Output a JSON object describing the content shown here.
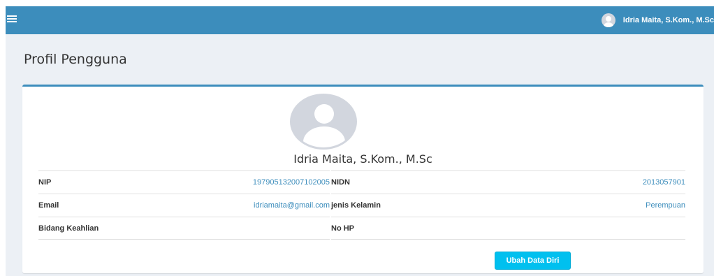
{
  "header": {
    "menu_icon": "hamburger-menu-icon",
    "user_name": "Idria Maita, S.Kom., M.Sc",
    "brand_color": "#3c8dbc"
  },
  "page": {
    "title": "Profil Pengguna"
  },
  "profile": {
    "name": "Idria Maita, S.Kom., M.Sc",
    "left": [
      {
        "label": "NIP",
        "value": "197905132007102005"
      },
      {
        "label": "Email",
        "value": "idriamaita@gmail.com"
      },
      {
        "label": "Bidang Keahlian",
        "value": ""
      }
    ],
    "right": [
      {
        "label": "NIDN",
        "value": "2013057901"
      },
      {
        "label": "jenis Kelamin",
        "value": "Perempuan"
      },
      {
        "label": "No HP",
        "value": ""
      }
    ],
    "edit_button": "Ubah Data Diri",
    "button_color": "#00c0ef"
  }
}
